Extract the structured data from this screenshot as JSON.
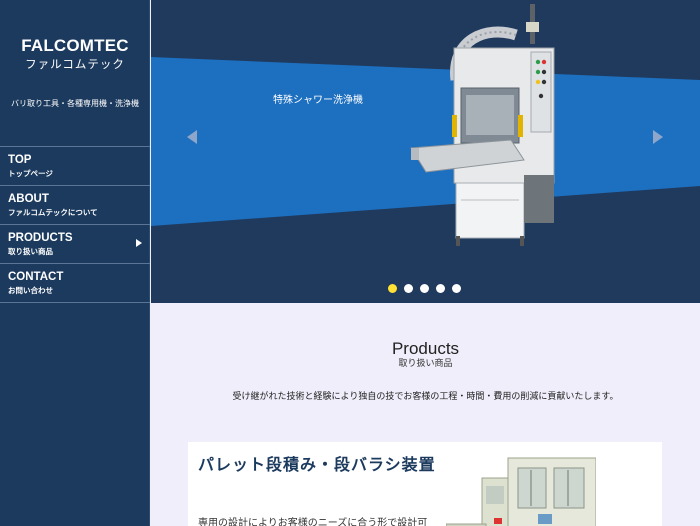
{
  "brand": {
    "name_en": "FALCOMTEC",
    "name_ja": "ファルコムテック",
    "tagline": "バリ取り工具・各種専用機・洗浄機"
  },
  "nav": [
    {
      "label": "TOP",
      "sub": "トップページ"
    },
    {
      "label": "ABOUT",
      "sub": "ファルコムテックについて"
    },
    {
      "label": "PRODUCTS",
      "sub": "取り扱い商品"
    },
    {
      "label": "CONTACT",
      "sub": "お問い合わせ"
    }
  ],
  "hero": {
    "caption": "特殊シャワー洗浄機",
    "slide_count": 5,
    "active_slide": 1
  },
  "products": {
    "title": "Products",
    "subtitle": "取り扱い商品",
    "description": "受け継がれた技術と経験により独自の技でお客様の工程・時間・費用の削減に貢献いたします。"
  },
  "card": {
    "title": "パレット段積み・段バラシ装置",
    "text": "専用の設計によりお客様のニーズに合う形で設計可"
  },
  "colors": {
    "sidebar": "#1c3a5e",
    "hero_band": "#1d6fc0",
    "accent_dot": "#ffe135",
    "content_bg": "#efeefa"
  }
}
